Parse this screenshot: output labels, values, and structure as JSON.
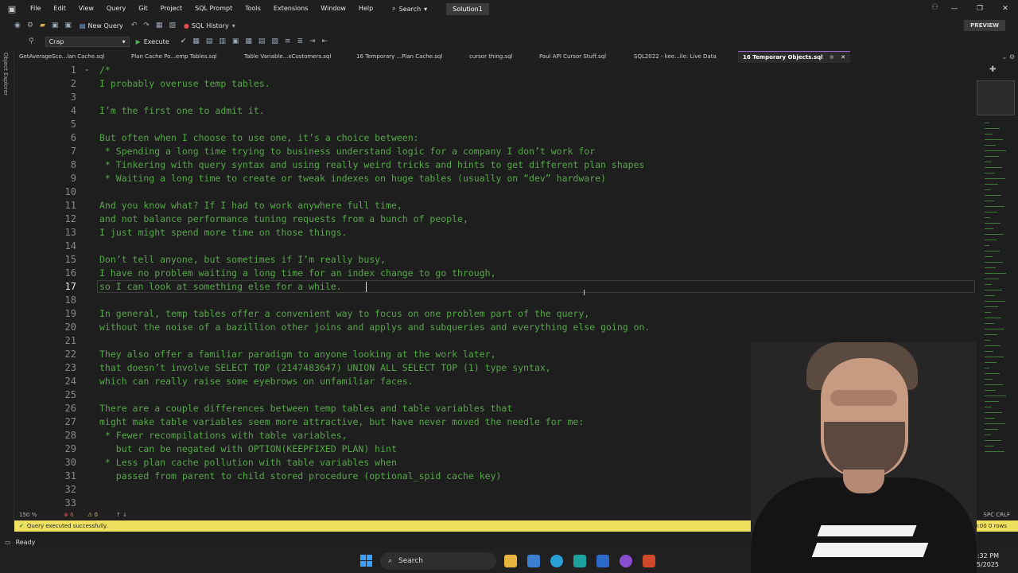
{
  "titlebar": {
    "menu": [
      "File",
      "Edit",
      "View",
      "Query",
      "Git",
      "Project",
      "SQL Prompt",
      "Tools",
      "Extensions",
      "Window",
      "Help"
    ],
    "search_label": "Search",
    "solution": "Solution1"
  },
  "toolbar": {
    "new_query": "New Query",
    "sql_history": "SQL History",
    "preview": "PREVIEW",
    "database": "Crap",
    "execute": "Execute"
  },
  "left_rail_label": "Object Explorer",
  "tabs": [
    "GetAverageSco...lan Cache.sql",
    "Plan Cache Po...emp Tables.sql",
    "Table Variable...xCustomers.sql",
    "16 Temporary ...Plan Cache.sql",
    "cursor thing.sql",
    "Paul API Cursor Stuff.sql",
    "SQL2022 - kee...ile: Live Data",
    "16 Temporary Objects.sql"
  ],
  "editor": {
    "current_line": 17,
    "lines": [
      {
        "n": "1",
        "text": "/*"
      },
      {
        "n": "2",
        "text": "I probably overuse temp tables."
      },
      {
        "n": "3",
        "text": ""
      },
      {
        "n": "4",
        "text": "I’m the first one to admit it."
      },
      {
        "n": "5",
        "text": ""
      },
      {
        "n": "6",
        "text": "But often when I choose to use one, it’s a choice between:"
      },
      {
        "n": "7",
        "text": " * Spending a long time trying to business understand logic for a company I don’t work for"
      },
      {
        "n": "8",
        "text": " * Tinkering with query syntax and using really weird tricks and hints to get different plan shapes"
      },
      {
        "n": "9",
        "text": " * Waiting a long time to create or tweak indexes on huge tables (usually on “dev” hardware)"
      },
      {
        "n": "10",
        "text": ""
      },
      {
        "n": "11",
        "text": "And you know what? If I had to work anywhere full time,"
      },
      {
        "n": "12",
        "text": "and not balance performance tuning requests from a bunch of people,"
      },
      {
        "n": "13",
        "text": "I just might spend more time on those things."
      },
      {
        "n": "14",
        "text": ""
      },
      {
        "n": "15",
        "text": "Don’t tell anyone, but sometimes if I’m really busy,"
      },
      {
        "n": "16",
        "text": "I have no problem waiting a long time for an index change to go through,"
      },
      {
        "n": "17",
        "text": "so I can look at something else for a while."
      },
      {
        "n": "18",
        "text": ""
      },
      {
        "n": "19",
        "text": "In general, temp tables offer a convenient way to focus on one problem part of the query,"
      },
      {
        "n": "20",
        "text": "without the noise of a bazillion other joins and applys and subqueries and everything else going on."
      },
      {
        "n": "21",
        "text": ""
      },
      {
        "n": "22",
        "text": "They also offer a familiar paradigm to anyone looking at the work later,"
      },
      {
        "n": "23",
        "text": "that doesn’t involve SELECT TOP (2147483647) UNION ALL SELECT TOP (1) type syntax,"
      },
      {
        "n": "24",
        "text": "which can really raise some eyebrows on unfamiliar faces."
      },
      {
        "n": "25",
        "text": ""
      },
      {
        "n": "26",
        "text": "There are a couple differences between temp tables and table variables that"
      },
      {
        "n": "27",
        "text": "might make table variables seem more attractive, but have never moved the needle for me:"
      },
      {
        "n": "28",
        "text": " * Fewer recompilations with table variables,"
      },
      {
        "n": "29",
        "text": "   but can be negated with OPTION(KEEPFIXED PLAN) hint"
      },
      {
        "n": "30",
        "text": " * Less plan cache pollution with table variables when"
      },
      {
        "n": "31",
        "text": "   passed from parent to child stored procedure (optional_spid cache key)"
      },
      {
        "n": "32",
        "text": ""
      },
      {
        "n": "33",
        "text": ""
      }
    ]
  },
  "editor_status": {
    "zoom": "150 %",
    "errors": "6",
    "warnings": "0",
    "encoding": "SPC   CRLF"
  },
  "query_status": {
    "message": "Query executed successfully.",
    "rows": "00:00:00   0 rows"
  },
  "statusbar": {
    "ready": "Ready"
  },
  "taskbar": {
    "search": "Search",
    "time": "2:32 PM",
    "date": "15/2025"
  }
}
